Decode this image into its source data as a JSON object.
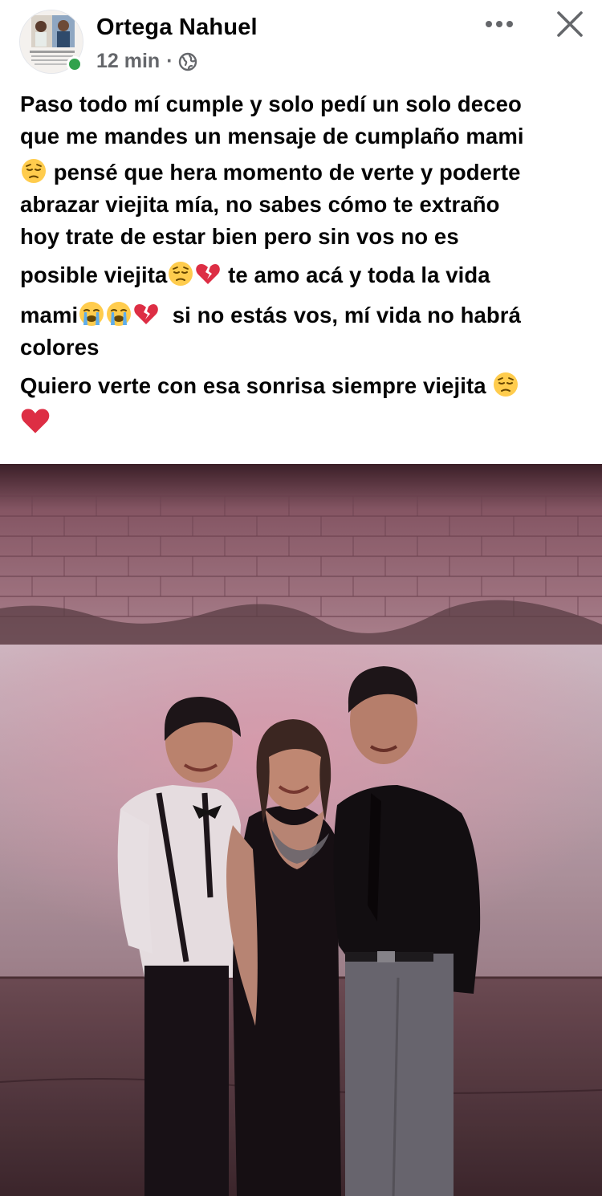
{
  "post": {
    "author": "Ortega Nahuel",
    "time": "12 min",
    "separator": "·",
    "privacy_icon": "globe-icon",
    "more_icon": "more-options-icon",
    "close_icon": "close-icon",
    "text_lines": [
      "Paso todo mí cumple y solo pedí un solo deceo",
      "que me mandes un mensaje de cumplaño mami",
      " pensé que hera momento de verte y poderte",
      "abrazar viejita mía, no sabes cómo te extraño",
      "hoy trate de estar bien pero sin vos no es",
      "posible viejita",
      " te amo acá y toda la vida",
      "mami",
      "  si no estás vos, mí vida no habrá",
      "colores",
      "Quiero verte con esa sonrisa siempre viejita "
    ]
  },
  "colors": {
    "online": "#31a24c",
    "meta_text": "#65676b",
    "text": "#050505"
  }
}
